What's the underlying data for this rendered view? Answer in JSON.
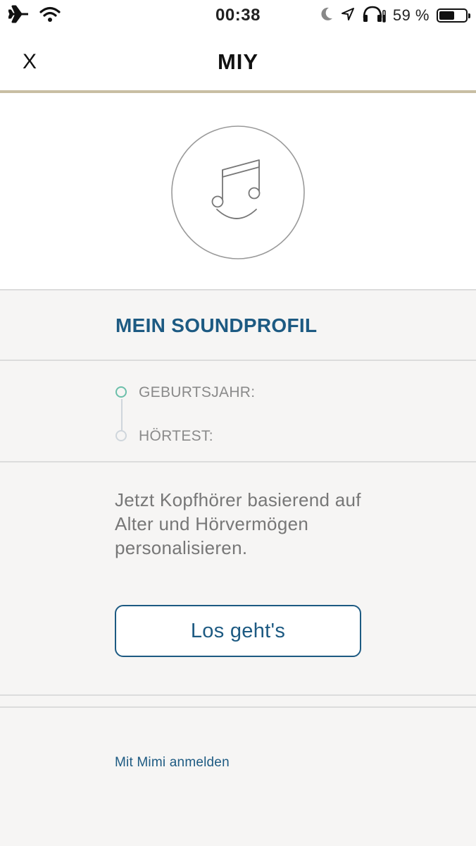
{
  "status_bar": {
    "time": "00:38",
    "battery_percent_label": "59 %",
    "battery_level": 0.59,
    "icons": [
      "airplane-icon",
      "wifi-icon",
      "moon-icon",
      "location-icon",
      "headphones-icon",
      "battery-icon"
    ]
  },
  "header": {
    "close_label": "X",
    "title": "MIY"
  },
  "hero": {
    "icon": "music-note-smile-icon"
  },
  "profile": {
    "title": "MEIN SOUNDPROFIL",
    "steps": [
      {
        "label": "GEBURTSJAHR:",
        "state": "active"
      },
      {
        "label": "HÖRTEST:",
        "state": "inactive"
      }
    ]
  },
  "intro": {
    "text": "Jetzt Kopfhörer basierend auf Alter und Hörvermögen personalisieren.",
    "button_label": "Los geht's"
  },
  "footer": {
    "signin_link": "Mit Mimi anmelden"
  },
  "colors": {
    "accent": "#1d5a82",
    "step_active": "#6bbfaa",
    "header_border": "#c8bea3"
  }
}
